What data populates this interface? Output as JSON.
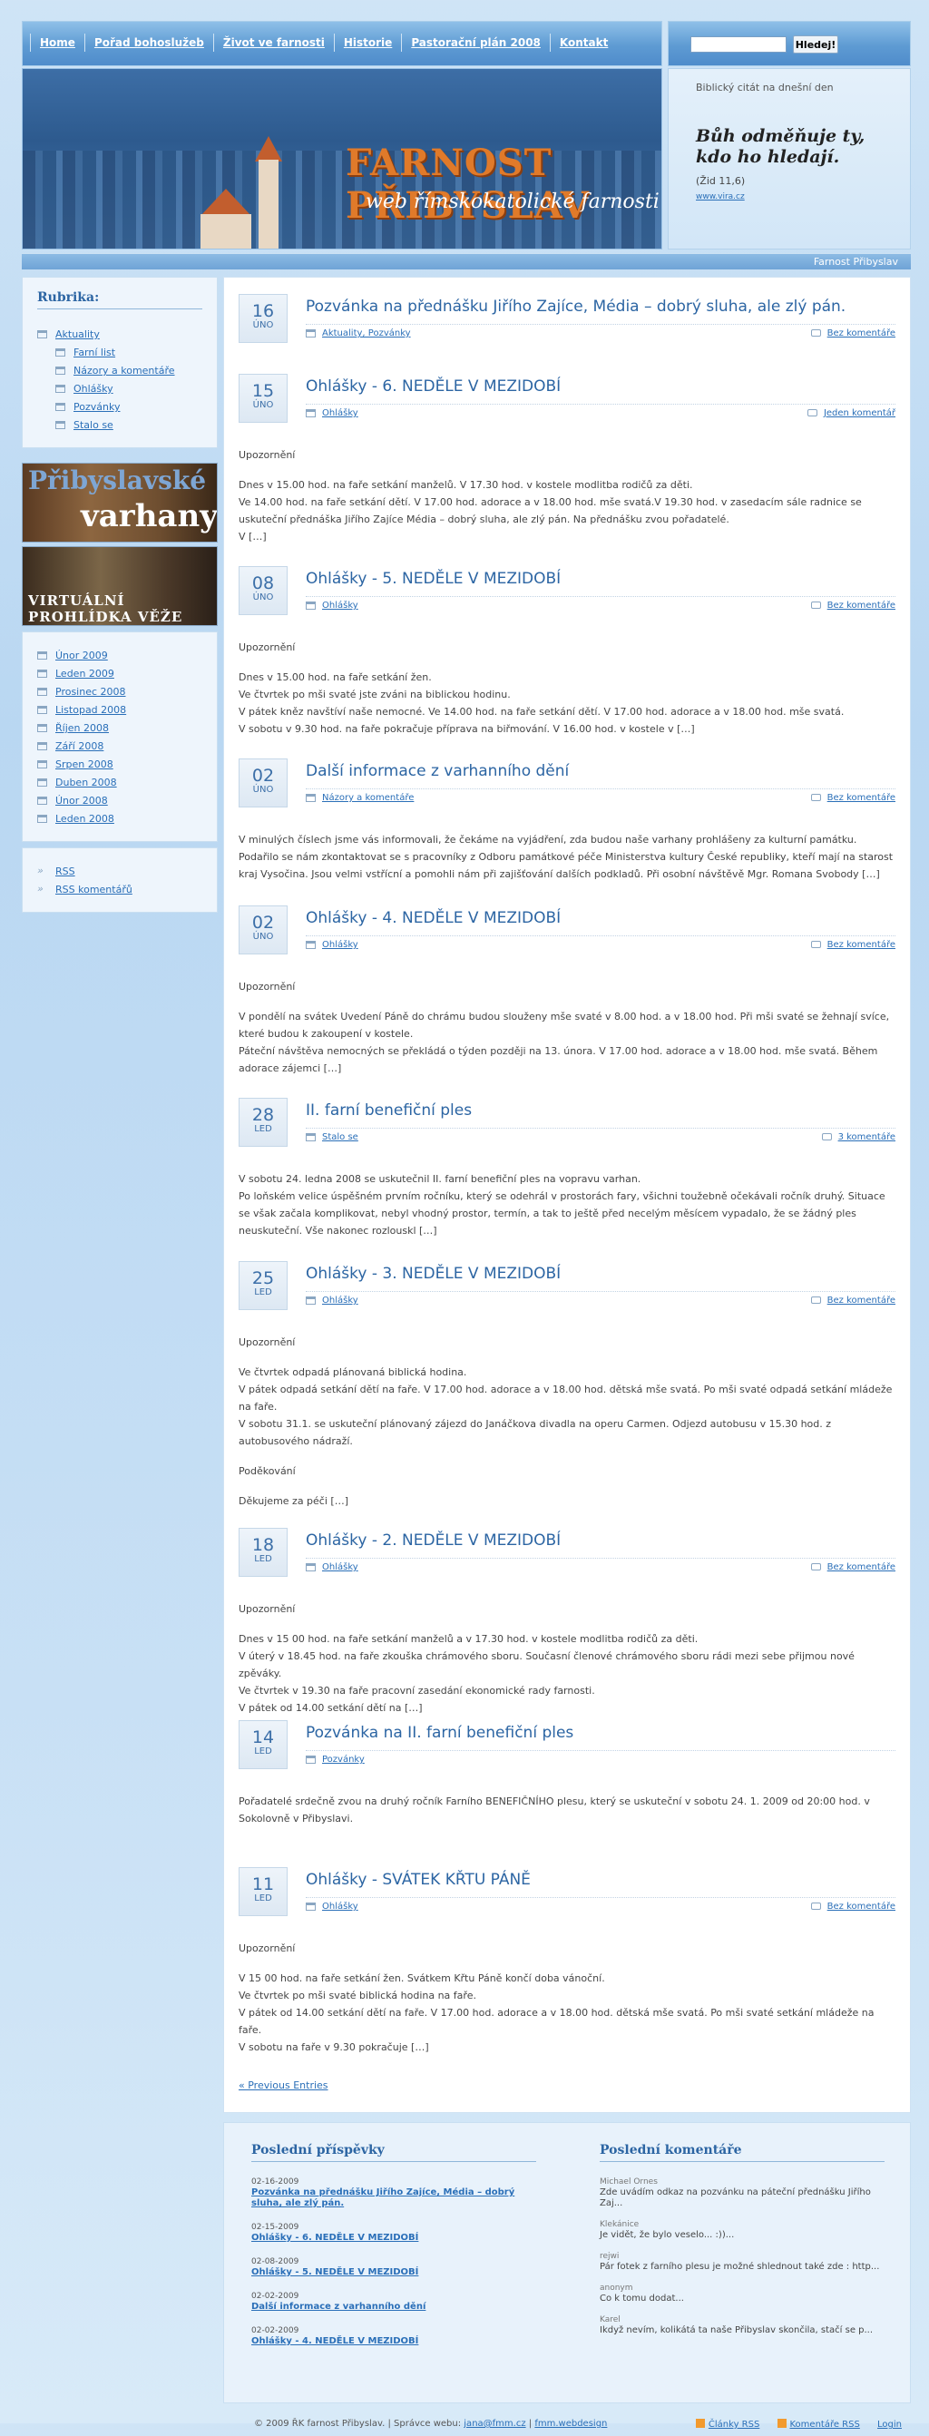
{
  "nav": {
    "items": [
      "Home",
      "Pořad bohoslužeb",
      "Život ve farnosti",
      "Historie",
      "Pastorační plán 2008",
      "Kontakt"
    ],
    "search_button": "Hledej!",
    "search_value": ""
  },
  "banner": {
    "title": "FARNOST PŘIBYSLAV",
    "subtitle": "web římskokatolické farnosti"
  },
  "quote": {
    "label": "Biblický citát na dnešní den",
    "text": "Bůh odměňuje ty, kdo ho hledají.",
    "ref": "(Žid 11,6)",
    "source": "www.vira.cz"
  },
  "strip": {
    "site_name": "Farnost Přibyslav"
  },
  "sidebar": {
    "rubrika_title": "Rubrika:",
    "categories": [
      {
        "label": "Aktuality",
        "sub": false
      },
      {
        "label": "Farní list",
        "sub": true
      },
      {
        "label": "Názory a komentáře",
        "sub": true
      },
      {
        "label": "Ohlášky",
        "sub": true
      },
      {
        "label": "Pozvánky",
        "sub": true
      },
      {
        "label": "Stalo se",
        "sub": true
      }
    ],
    "promo1": {
      "line1": "Přibyslavské",
      "line2": "varhany"
    },
    "promo2": {
      "line1": "VIRTUÁLNÍ PROHLÍDKA VĚŽE"
    },
    "archive": [
      "Únor 2009",
      "Leden 2009",
      "Prosinec 2008",
      "Listopad 2008",
      "Říjen 2008",
      "Září 2008",
      "Srpen 2008",
      "Duben 2008",
      "Únor 2008",
      "Leden 2008"
    ],
    "feeds": [
      "RSS",
      "RSS komentářů"
    ]
  },
  "posts": [
    {
      "day": "16",
      "month": "ÚNO",
      "title": "Pozvánka na přednášku Jiřího Zajíce, Média – dobrý sluha, ale zlý pán.",
      "cats": "Aktuality, Pozvánky",
      "comments": "Bez komentáře",
      "body": []
    },
    {
      "day": "15",
      "month": "ÚNO",
      "title": "Ohlášky - 6. NEDĚLE V MEZIDOBÍ",
      "cats": "Ohlášky",
      "comments": "Jeden komentář",
      "body": [
        "Upozornění",
        "Dnes v 15.00 hod. na faře setkání manželů. V 17.30 hod. v kostele modlitba rodičů za děti.\nVe 14.00 hod. na faře setkání dětí. V 17.00 hod. adorace a v 18.00 hod. mše svatá.V 19.30 hod. v zasedacím sále radnice se uskuteční přednáška Jiřího Zajíce Média – dobrý sluha, ale zlý pán. Na přednášku zvou pořadatelé.\nV […]"
      ]
    },
    {
      "day": "08",
      "month": "ÚNO",
      "title": "Ohlášky - 5. NEDĚLE V MEZIDOBÍ",
      "cats": "Ohlášky",
      "comments": "Bez komentáře",
      "body": [
        "Upozornění",
        "Dnes v 15.00 hod. na faře setkání žen.\nVe čtvrtek po mši svaté jste zváni na biblickou hodinu.\nV pátek kněz navštíví naše nemocné. Ve 14.00 hod. na faře setkání dětí. V 17.00 hod. adorace a v 18.00 hod. mše svatá.\nV sobotu v 9.30 hod. na faře pokračuje příprava na biřmování. V 16.00 hod. v kostele v […]"
      ]
    },
    {
      "day": "02",
      "month": "ÚNO",
      "title": "Další informace z varhanního dění",
      "cats": "Názory a komentáře",
      "comments": "Bez komentáře",
      "body": [
        "V minulých číslech jsme vás informovali, že čekáme na vyjádření, zda budou naše varhany prohlášeny za kulturní památku. Podařilo se nám zkontaktovat se s pracovníky z Odboru památkové péče Ministerstva kultury České republiky, kteří mají na starost kraj Vysočina. Jsou velmi vstřícní a pomohli nám při zajišťování dalších podkladů. Při osobní návštěvě Mgr. Romana Svobody […]"
      ]
    },
    {
      "day": "02",
      "month": "ÚNO",
      "title": "Ohlášky - 4. NEDĚLE V MEZIDOBÍ",
      "cats": "Ohlášky",
      "comments": "Bez komentáře",
      "body": [
        "Upozornění",
        "V pondělí na svátek Uvedení Páně do chrámu budou slouženy mše svaté v 8.00 hod. a v 18.00 hod. Při mši svaté se žehnají svíce, které budou k zakoupení v kostele.\nPáteční návštěva nemocných se překládá o týden později na 13. února. V 17.00 hod. adorace a v 18.00 hod. mše svatá. Během adorace zájemci […]"
      ]
    },
    {
      "day": "28",
      "month": "LED",
      "title": "II. farní benefiční ples",
      "cats": "Stalo se",
      "comments": "3 komentáře",
      "body": [
        "V sobotu 24. ledna 2008 se uskutečnil II. farní benefiční ples na vopravu varhan.\nPo loňském velice úspěšném prvním ročníku, který se odehrál v prostorách fary, všichni toužebně očekávali ročník druhý. Situace se však začala komplikovat, nebyl vhodný prostor, termín, a tak to ještě před necelým měsícem vypadalo, že se žádný ples neuskuteční. Vše nakonec rozlouskl […]"
      ]
    },
    {
      "day": "25",
      "month": "LED",
      "title": "Ohlášky - 3. NEDĚLE V MEZIDOBÍ",
      "cats": "Ohlášky",
      "comments": "Bez komentáře",
      "body": [
        "Upozornění",
        "Ve čtvrtek odpadá plánovaná biblická hodina.\nV pátek odpadá setkání dětí na faře. V 17.00 hod. adorace a v 18.00 hod. dětská mše svatá. Po mši svaté odpadá setkání mládeže na faře.\nV sobotu 31.1. se uskuteční plánovaný zájezd do Janáčkova divadla na operu Carmen. Odjezd autobusu v 15.30 hod. z autobusového nádraží.",
        "Poděkování",
        "Děkujeme za péči […]"
      ]
    },
    {
      "day": "18",
      "month": "LED",
      "title": "Ohlášky - 2. NEDĚLE V MEZIDOBÍ",
      "cats": "Ohlášky",
      "comments": "Bez komentáře",
      "body": [
        "Upozornění",
        "Dnes v 15 00 hod. na faře setkání manželů a v 17.30 hod. v kostele modlitba rodičů za děti.\nV úterý v 18.45 hod. na faře zkouška chrámového sboru. Současní členové chrámového sboru rádi mezi sebe přijmou nové zpěváky.\nVe čtvrtek v 19.30 na faře pracovní zasedání ekonomické rady farnosti.\nV pátek od 14.00 setkání dětí na […]"
      ]
    },
    {
      "day": "14",
      "month": "LED",
      "title": "Pozvánka na II. farní benefiční ples",
      "cats": "Pozvánky",
      "comments": "",
      "body": [
        "Pořadatelé srdečně zvou na druhý ročník Farního BENEFIČNÍHO plesu, který se uskuteční v sobotu 24. 1. 2009 od 20:00 hod. v Sokolovně v Přibyslavi."
      ]
    },
    {
      "day": "11",
      "month": "LED",
      "title": "Ohlášky - SVÁTEK KŘTU PÁNĚ",
      "cats": "Ohlášky",
      "comments": "Bez komentáře",
      "body": [
        "Upozornění",
        "V 15 00 hod. na faře setkání žen. Svátkem Křtu Páně končí doba vánoční.\nVe čtvrtek po mši svaté biblická hodina na faře.\nV pátek od 14.00 setkání dětí na faře. V 17.00 hod. adorace a v 18.00 hod. dětská mše svatá. Po mši svaté setkání mládeže na faře.\nV sobotu na faře v 9.30 pokračuje […]"
      ]
    }
  ],
  "prev_link": "« Previous Entries",
  "footer_widgets": {
    "recent_title": "Poslední příspěvky",
    "recent": [
      {
        "date": "02-16-2009",
        "title": "Pozvánka na přednášku Jiřího Zajíce, Média – dobrý sluha, ale zlý pán."
      },
      {
        "date": "02-15-2009",
        "title": "Ohlášky - 6. NEDĚLE V MEZIDOBÍ"
      },
      {
        "date": "02-08-2009",
        "title": "Ohlášky - 5. NEDĚLE V MEZIDOBÍ"
      },
      {
        "date": "02-02-2009",
        "title": "Další informace z varhanního dění"
      },
      {
        "date": "02-02-2009",
        "title": "Ohlášky - 4. NEDĚLE V MEZIDOBÍ"
      }
    ],
    "comments_title": "Poslední komentáře",
    "comments": [
      {
        "author": "Michael Ornes",
        "text": "Zde uvádím odkaz na pozvánku na páteční přednášku Jiřího Zaj..."
      },
      {
        "author": "Klekánice",
        "text": "Je vidět, že bylo veselo... :))..."
      },
      {
        "author": "rejwi",
        "text": "Pár fotek z farního plesu je možné shlednout také zde : http..."
      },
      {
        "author": "anonym",
        "text": "Co k tomu dodat..."
      },
      {
        "author": "Karel",
        "text": "Ikdyž nevím, kolikátá ta naše Přibyslav skončila, stačí se p..."
      }
    ]
  },
  "footer": {
    "copyright": "© 2009 ŘK farnost Přibyslav. | Správce webu:",
    "email": "jana@fmm.cz",
    "separator": "|",
    "webdesign": "fmm.webdesign",
    "rss_posts": "Články RSS",
    "rss_comments": "Komentáře RSS",
    "login": "Login"
  }
}
